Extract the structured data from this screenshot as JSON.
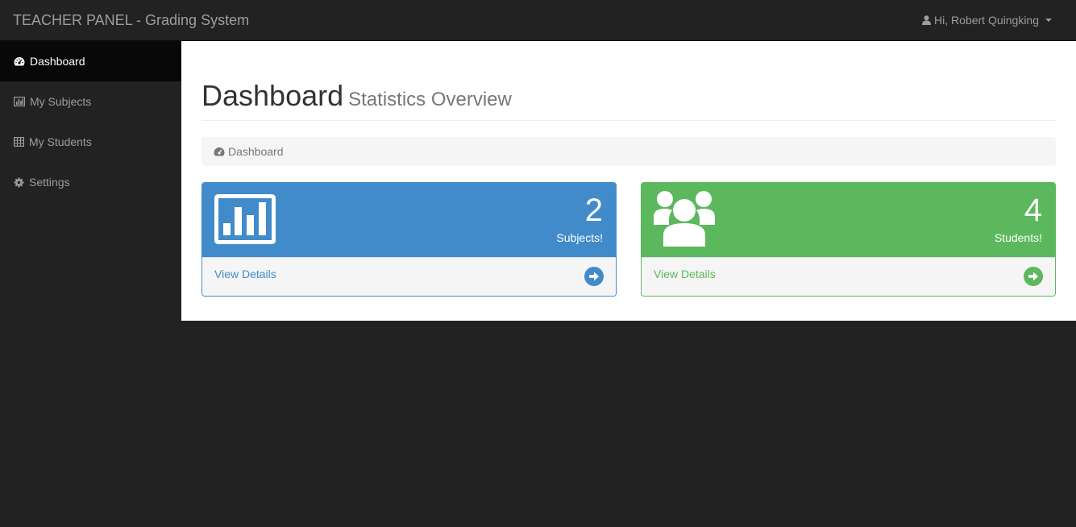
{
  "navbar": {
    "brand": "TEACHER PANEL - Grading System",
    "user_greeting": "Hi, Robert Quingking"
  },
  "sidebar": {
    "items": [
      {
        "label": "Dashboard",
        "icon": "dashboard-icon",
        "active": true
      },
      {
        "label": "My Subjects",
        "icon": "bar-chart-icon",
        "active": false
      },
      {
        "label": "My Students",
        "icon": "table-icon",
        "active": false
      },
      {
        "label": "Settings",
        "icon": "gear-icon",
        "active": false
      }
    ]
  },
  "main": {
    "title": "Dashboard",
    "subtitle": "Statistics Overview",
    "breadcrumb": "Dashboard",
    "panels": [
      {
        "count": "2",
        "label": "Subjects!",
        "link": "View Details",
        "color": "#428bca",
        "icon": "bar-chart-icon"
      },
      {
        "count": "4",
        "label": "Students!",
        "link": "View Details",
        "color": "#5cb85c",
        "icon": "users-icon"
      }
    ]
  },
  "colors": {
    "navbar_bg": "#222222",
    "active_item_bg": "#080808",
    "primary": "#428bca",
    "success": "#5cb85c"
  }
}
